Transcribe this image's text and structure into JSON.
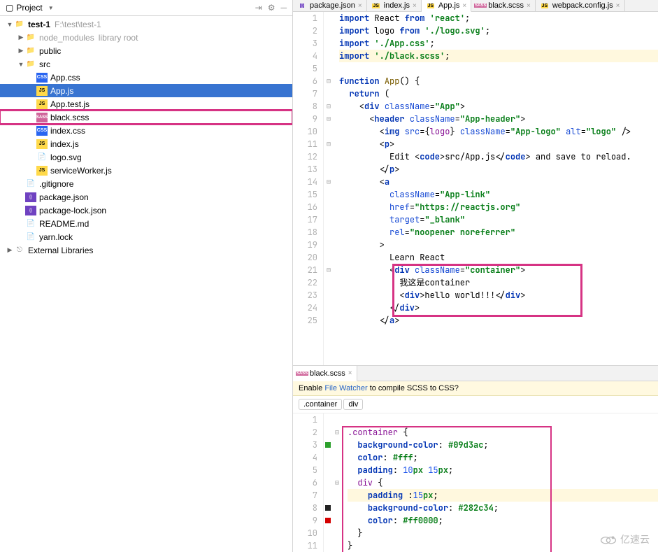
{
  "sidebar": {
    "title": "Project",
    "icons": [
      "collapse-icon",
      "gear-icon",
      "hide-icon"
    ],
    "tree": [
      {
        "indent": 0,
        "arrow": "▼",
        "icon": "folder",
        "label": "test-1",
        "hint": "F:\\test\\test-1",
        "cls": "bold"
      },
      {
        "indent": 1,
        "arrow": "▶",
        "icon": "folder",
        "label": "node_modules",
        "hint": "library root",
        "muted": true
      },
      {
        "indent": 1,
        "arrow": "▶",
        "icon": "folder",
        "label": "public"
      },
      {
        "indent": 1,
        "arrow": "▼",
        "icon": "folder",
        "label": "src"
      },
      {
        "indent": 2,
        "arrow": "",
        "icon": "css",
        "label": "App.css"
      },
      {
        "indent": 2,
        "arrow": "",
        "icon": "js",
        "label": "App.js",
        "selected": true
      },
      {
        "indent": 2,
        "arrow": "",
        "icon": "js",
        "label": "App.test.js"
      },
      {
        "indent": 2,
        "arrow": "",
        "icon": "scss",
        "label": "black.scss",
        "highlighted": true
      },
      {
        "indent": 2,
        "arrow": "",
        "icon": "css",
        "label": "index.css"
      },
      {
        "indent": 2,
        "arrow": "",
        "icon": "js",
        "label": "index.js"
      },
      {
        "indent": 2,
        "arrow": "",
        "icon": "file",
        "label": "logo.svg"
      },
      {
        "indent": 2,
        "arrow": "",
        "icon": "js",
        "label": "serviceWorker.js"
      },
      {
        "indent": 1,
        "arrow": "",
        "icon": "file",
        "label": ".gitignore"
      },
      {
        "indent": 1,
        "arrow": "",
        "icon": "json",
        "label": "package.json"
      },
      {
        "indent": 1,
        "arrow": "",
        "icon": "json",
        "label": "package-lock.json"
      },
      {
        "indent": 1,
        "arrow": "",
        "icon": "file",
        "label": "README.md"
      },
      {
        "indent": 1,
        "arrow": "",
        "icon": "file",
        "label": "yarn.lock"
      },
      {
        "indent": 0,
        "arrow": "▶",
        "icon": "lib",
        "label": "External Libraries"
      }
    ]
  },
  "tabs": [
    {
      "icon": "json",
      "label": "package.json",
      "active": false
    },
    {
      "icon": "js",
      "label": "index.js",
      "active": false
    },
    {
      "icon": "js",
      "label": "App.js",
      "active": true
    },
    {
      "icon": "scss",
      "label": "black.scss",
      "active": false
    },
    {
      "icon": "js",
      "label": "webpack.config.js",
      "active": false
    }
  ],
  "top_code": {
    "lines": [
      {
        "n": 1,
        "html": "<span class='kw'>import</span> React <span class='kw'>from</span> <span class='str'>'react'</span>;"
      },
      {
        "n": 2,
        "html": "<span class='kw'>import</span> logo <span class='kw'>from</span> <span class='str'>'./logo.svg'</span>;"
      },
      {
        "n": 3,
        "html": "<span class='kw'>import</span> <span class='str'>'./App.css'</span>;"
      },
      {
        "n": 4,
        "hl": true,
        "html": "<span class='kw'>import</span> <span class='str'>'./black.scss'</span>;"
      },
      {
        "n": 5,
        "html": ""
      },
      {
        "n": 6,
        "fold": "⊟",
        "html": "<span class='kw'>function</span> <span class='fn'>App</span>() {"
      },
      {
        "n": 7,
        "html": "  <span class='kw'>return</span> ("
      },
      {
        "n": 8,
        "fold": "⊟",
        "html": "    &lt;<span class='tag'>div</span> <span class='attr'>className</span>=<span class='attrval'>\"App\"</span>&gt;"
      },
      {
        "n": 9,
        "fold": "⊟",
        "html": "      &lt;<span class='tag'>header</span> <span class='attr'>className</span>=<span class='attrval'>\"App-header\"</span>&gt;"
      },
      {
        "n": 10,
        "html": "        &lt;<span class='tag'>img</span> <span class='attr'>src</span>={<span class='ident'>logo</span>} <span class='attr'>className</span>=<span class='attrval'>\"App-logo\"</span> <span class='attr'>alt</span>=<span class='attrval'>\"logo\"</span> /&gt;"
      },
      {
        "n": 11,
        "fold": "⊟",
        "html": "        &lt;<span class='tag'>p</span>&gt;"
      },
      {
        "n": 12,
        "html": "          Edit &lt;<span class='tag'>code</span>&gt;src/App.js&lt;/<span class='tag'>code</span>&gt; and save to reload."
      },
      {
        "n": 13,
        "html": "        &lt;/<span class='tag'>p</span>&gt;"
      },
      {
        "n": 14,
        "fold": "⊟",
        "html": "        &lt;<span class='tag'>a</span>"
      },
      {
        "n": 15,
        "html": "          <span class='attr'>className</span>=<span class='attrval'>\"App-link\"</span>"
      },
      {
        "n": 16,
        "html": "          <span class='attr'>href</span>=<span class='attrval'>\"https://reactjs.org\"</span>"
      },
      {
        "n": 17,
        "html": "          <span class='attr'>target</span>=<span class='attrval'>\"_blank\"</span>"
      },
      {
        "n": 18,
        "html": "          <span class='attr'>rel</span>=<span class='attrval'>\"noopener noreferrer\"</span>"
      },
      {
        "n": 19,
        "html": "        &gt;"
      },
      {
        "n": 20,
        "html": "          Learn React"
      },
      {
        "n": 21,
        "fold": "⊟",
        "html": "          &lt;<span class='tag'>div</span> <span class='attr'>className</span>=<span class='attrval'>\"container\"</span>&gt;"
      },
      {
        "n": 22,
        "html": "            我这是container"
      },
      {
        "n": 23,
        "html": "            &lt;<span class='tag'>div</span>&gt;hello world!!!&lt;/<span class='tag'>div</span>&gt;"
      },
      {
        "n": 24,
        "html": "          &lt;/<span class='tag'>div</span>&gt;"
      },
      {
        "n": 25,
        "html": "        &lt;/<span class='tag'>a</span>&gt;"
      }
    ]
  },
  "bottom_tabs": [
    {
      "icon": "scss",
      "label": "black.scss",
      "active": true
    }
  ],
  "file_watcher": {
    "prefix": "Enable ",
    "link": "File Watcher",
    "suffix": " to compile SCSS to CSS?"
  },
  "breadcrumbs": [
    ".container",
    "div"
  ],
  "bottom_code": {
    "lines": [
      {
        "n": 1,
        "html": ""
      },
      {
        "n": 2,
        "fold": "⊟",
        "html": "<span class='ident'>.container</span> {"
      },
      {
        "n": 3,
        "mark": "green",
        "html": "  <span class='prop'>background-color</span>: <span class='val'>#09d3ac</span>;"
      },
      {
        "n": 4,
        "mark": "",
        "html": "  <span class='prop'>color</span>: <span class='val'>#fff</span>;"
      },
      {
        "n": 5,
        "html": "  <span class='prop'>padding</span>: <span class='num'>10</span><span class='val'>px</span> <span class='num'>15</span><span class='val'>px</span>;"
      },
      {
        "n": 6,
        "fold": "⊟",
        "html": "  <span class='ident'>div</span> {"
      },
      {
        "n": 7,
        "hl": true,
        "html": "    <span class='prop'>padding</span> :<span class='num'>15</span><span class='val'>px</span>;"
      },
      {
        "n": 8,
        "mark": "black",
        "html": "    <span class='prop'>background-color</span>: <span class='val'>#282c34</span>;"
      },
      {
        "n": 9,
        "mark": "red",
        "html": "    <span class='prop'>color</span>: <span class='val'>#ff0000</span>;"
      },
      {
        "n": 10,
        "html": "  }"
      },
      {
        "n": 11,
        "html": "}"
      }
    ]
  },
  "watermark": "亿速云"
}
